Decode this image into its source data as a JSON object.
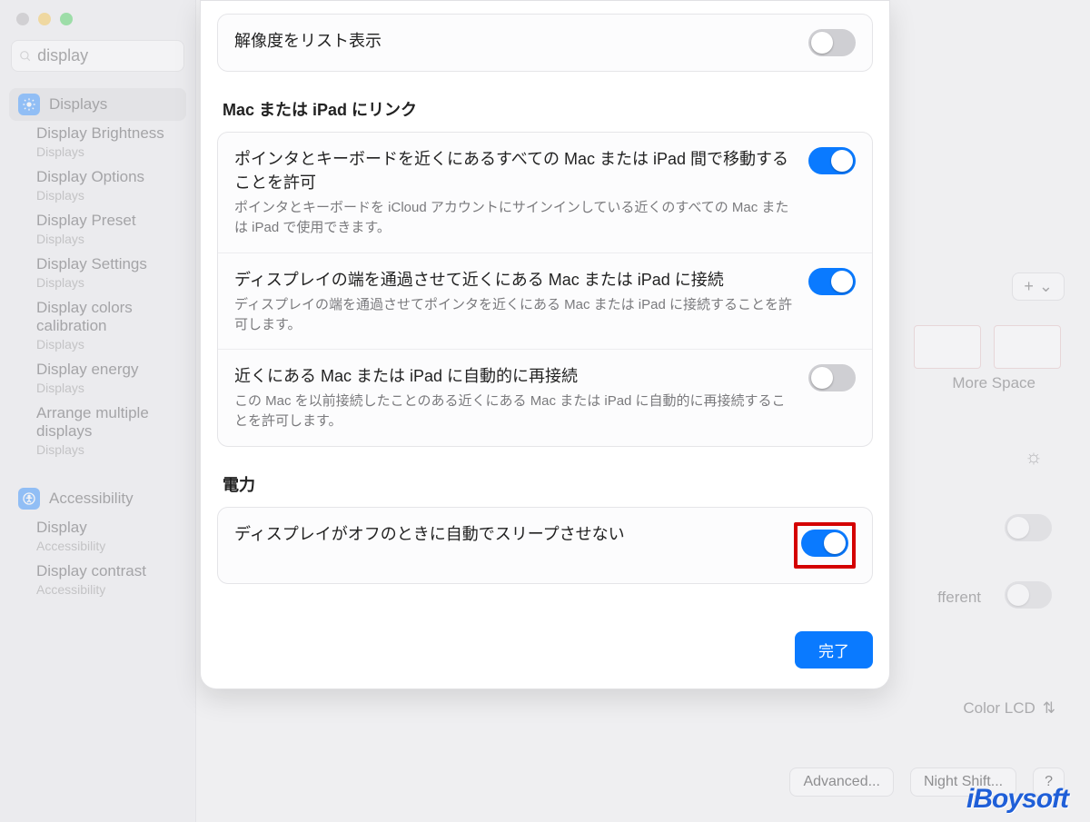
{
  "window": {
    "search_value": "display"
  },
  "sidebar": {
    "displays": {
      "label": "Displays",
      "items": [
        {
          "title": "Display Brightness",
          "cat": "Displays"
        },
        {
          "title": "Display Options",
          "cat": "Displays"
        },
        {
          "title": "Display Preset",
          "cat": "Displays"
        },
        {
          "title": "Display Settings",
          "cat": "Displays"
        },
        {
          "title": "Display colors calibration",
          "cat": "Displays"
        },
        {
          "title": "Display energy",
          "cat": "Displays"
        },
        {
          "title": "Arrange multiple displays",
          "cat": "Displays"
        }
      ]
    },
    "accessibility": {
      "label": "Accessibility",
      "items": [
        {
          "title": "Display",
          "cat": "Accessibility"
        },
        {
          "title": "Display contrast",
          "cat": "Accessibility"
        }
      ]
    }
  },
  "sheet": {
    "top_row": {
      "label": "解像度をリスト表示",
      "on": false
    },
    "link_section_title": "Mac または iPad にリンク",
    "link_rows": [
      {
        "title": "ポインタとキーボードを近くにあるすべての Mac または iPad 間で移動することを許可",
        "desc": "ポインタとキーボードを iCloud アカウントにサインインしている近くのすべての Mac または iPad で使用できます。",
        "on": true
      },
      {
        "title": "ディスプレイの端を通過させて近くにある Mac または iPad に接続",
        "desc": "ディスプレイの端を通過させてポインタを近くにある Mac または iPad に接続することを許可します。",
        "on": true
      },
      {
        "title": "近くにある Mac または iPad に自動的に再接続",
        "desc": "この Mac を以前接続したことのある近くにある Mac または iPad に自動的に再接続することを許可します。",
        "on": false
      }
    ],
    "power_section_title": "電力",
    "power_row": {
      "title": "ディスプレイがオフのときに自動でスリープさせない",
      "on": true
    },
    "done_label": "完了"
  },
  "main": {
    "add_label": "+",
    "more_space": "More Space",
    "different": "fferent",
    "color_lcd": "Color LCD",
    "advanced": "Advanced...",
    "night_shift": "Night Shift...",
    "help": "?"
  },
  "watermark": "iBoysoft"
}
